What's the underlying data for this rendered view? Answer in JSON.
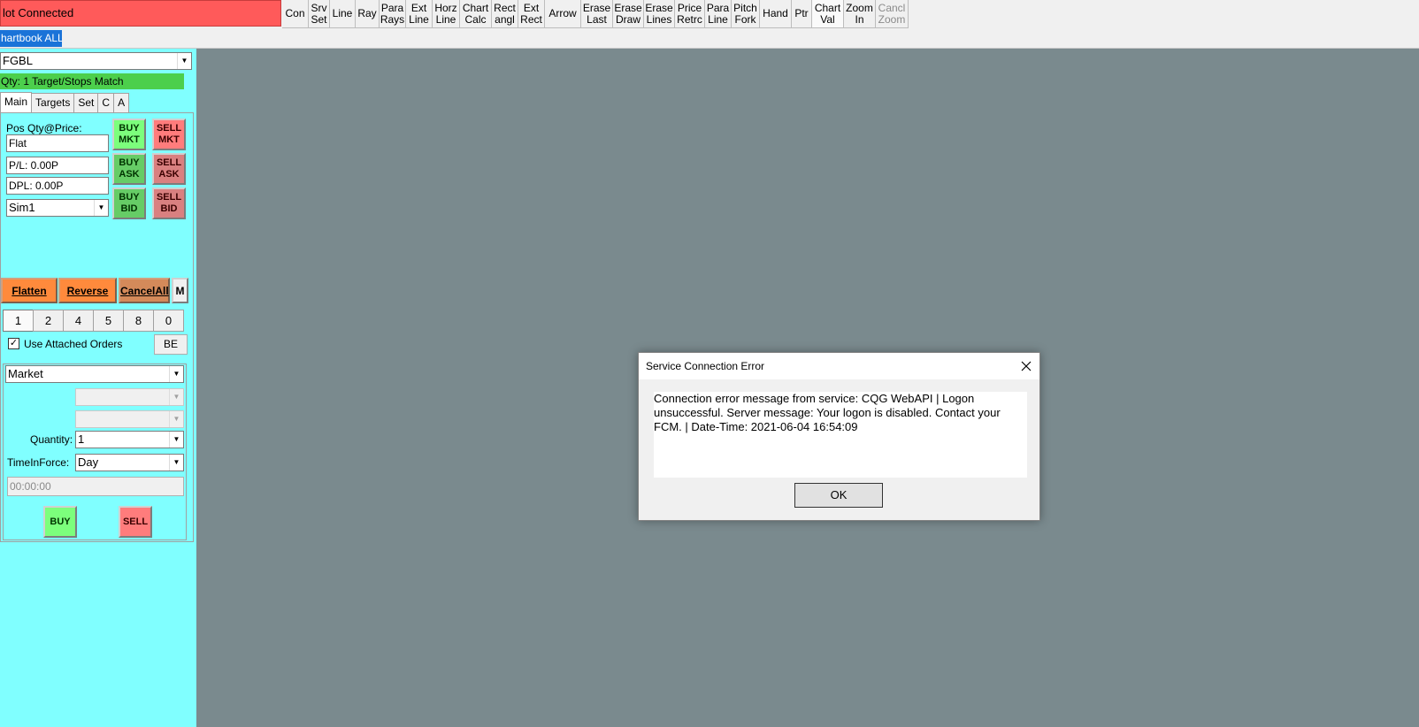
{
  "status": {
    "text": "lot Connected",
    "color": "#ff5a5a"
  },
  "toolbar": {
    "buttons": [
      {
        "line1": "Con",
        "line2": ""
      },
      {
        "line1": "Srv",
        "line2": "Set"
      },
      {
        "line1": "Line",
        "line2": ""
      },
      {
        "line1": "Ray",
        "line2": ""
      },
      {
        "line1": "Para",
        "line2": "Rays"
      },
      {
        "line1": "Ext",
        "line2": "Line"
      },
      {
        "line1": "Horz",
        "line2": "Line"
      },
      {
        "line1": "Chart",
        "line2": "Calc"
      },
      {
        "line1": "Rect",
        "line2": "angl"
      },
      {
        "line1": "Ext",
        "line2": "Rect"
      },
      {
        "line1": "Arrow",
        "line2": ""
      },
      {
        "line1": "Erase",
        "line2": "Last"
      },
      {
        "line1": "Erase",
        "line2": "Draw"
      },
      {
        "line1": "Erase",
        "line2": "Lines"
      },
      {
        "line1": "Price",
        "line2": "Retrc"
      },
      {
        "line1": "Para",
        "line2": "Line"
      },
      {
        "line1": "Pitch",
        "line2": "Fork"
      },
      {
        "line1": "Hand",
        "line2": ""
      },
      {
        "line1": "Ptr",
        "line2": ""
      },
      {
        "line1": "Chart",
        "line2": "Val"
      },
      {
        "line1": "Zoom",
        "line2": "In"
      },
      {
        "line1": "Cancl",
        "line2": "Zoom"
      }
    ]
  },
  "chartbook": {
    "label": "hartbook ALL"
  },
  "symbol": {
    "value": "FGBL"
  },
  "match_bar": {
    "text": "Qty: 1 Target/Stops Match"
  },
  "tabs": [
    "Main",
    "Targets",
    "Set",
    "C",
    "A"
  ],
  "position": {
    "label": "Pos Qty@Price:",
    "value": "Flat",
    "pl": "P/L: 0.00P",
    "dpl": "DPL: 0.00P",
    "account": "Sim1"
  },
  "order_buttons": {
    "buy_mkt": "BUY\nMKT",
    "sell_mkt": "SELL\nMKT",
    "buy_ask": "BUY\nASK",
    "sell_ask": "SELL\nASK",
    "buy_bid": "BUY\nBID",
    "sell_bid": "SELL\nBID"
  },
  "actions": {
    "flatten": "Flatten",
    "reverse": "Reverse",
    "cancel_all": "CancelAll",
    "m": "M"
  },
  "quantities": [
    "1",
    "2",
    "4",
    "5",
    "8",
    "0"
  ],
  "attached": {
    "label": "Use Attached Orders",
    "checked": "✓",
    "be": "BE"
  },
  "order_form": {
    "type": "Market",
    "quantity_label": "Quantity:",
    "quantity": "1",
    "tif_label": "TimeInForce:",
    "tif": "Day",
    "time": "00:00:00",
    "buy": "BUY",
    "sell": "SELL"
  },
  "dialog": {
    "title": "Service Connection Error",
    "message_line1": "Connection error message from service: CQG WebAPI | Logon",
    "message_line2": "unsuccessful. Server message: Your logon is disabled. Contact your",
    "message_line3": "FCM. | Date-Time: 2021-06-04  16:54:09",
    "ok": "OK"
  },
  "colors": {
    "panel": "#80ffff",
    "chart_bg": "#7a8a8e",
    "buy": "#7cff7c",
    "sell": "#ff7c7c",
    "action": "#ff8a3c",
    "match": "#4ccf4c"
  }
}
